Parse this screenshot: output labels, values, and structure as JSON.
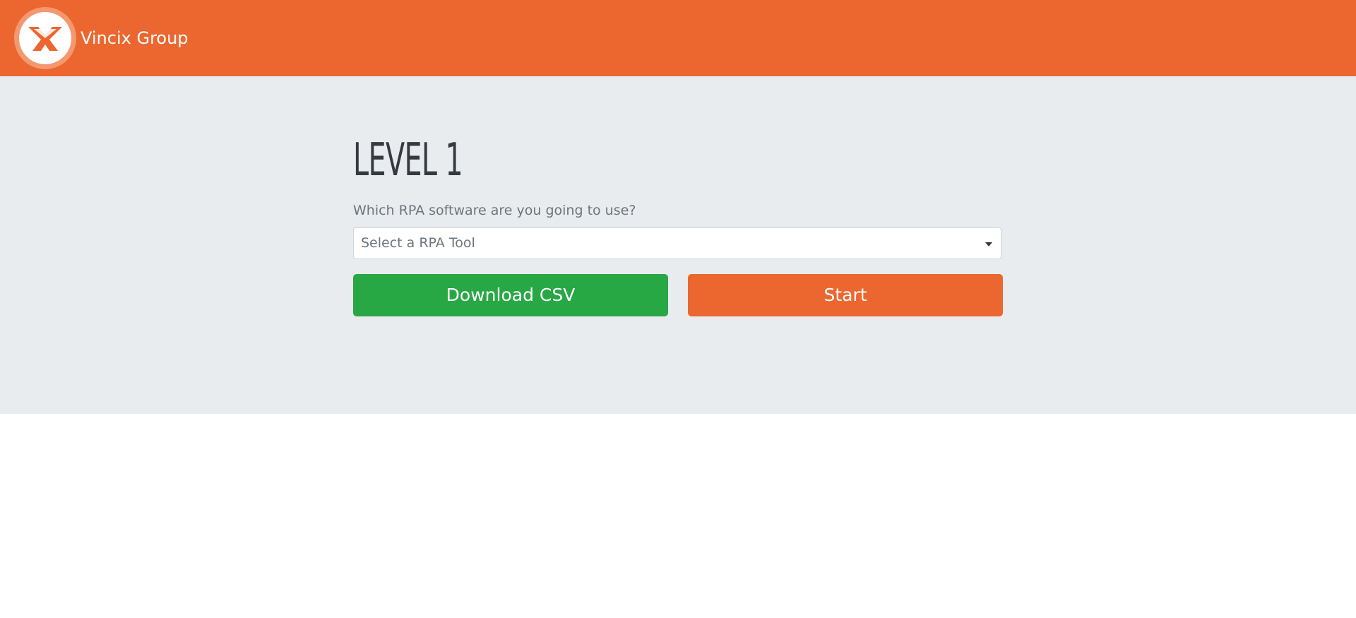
{
  "navbar": {
    "brand_name": "Vincix Group",
    "logo_icon": "vincix-logo-icon"
  },
  "main": {
    "title": "LEVEL 1",
    "question": "Which RPA software are you going to use?",
    "select": {
      "placeholder": "Select a RPA Tool"
    },
    "buttons": {
      "download_label": "Download CSV",
      "start_label": "Start"
    }
  },
  "colors": {
    "brand_orange": "#eb672f",
    "success_green": "#28a745",
    "jumbotron_bg": "#e9ecef"
  }
}
